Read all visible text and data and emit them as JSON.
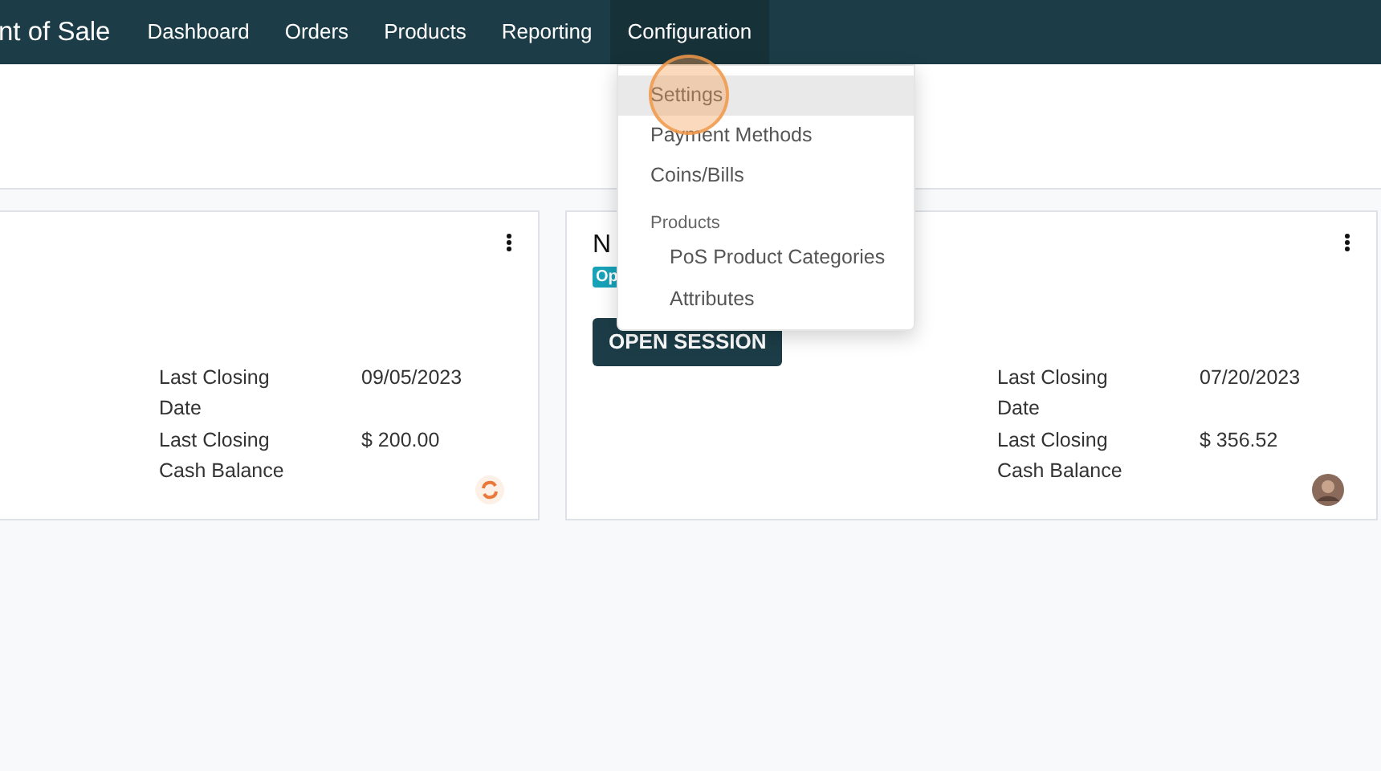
{
  "navbar": {
    "app_title": "nt of Sale",
    "menus": [
      {
        "label": "Dashboard",
        "selected": false
      },
      {
        "label": "Orders",
        "selected": false
      },
      {
        "label": "Products",
        "selected": false
      },
      {
        "label": "Reporting",
        "selected": false
      },
      {
        "label": "Configuration",
        "selected": true
      }
    ]
  },
  "dropdown": {
    "items": [
      {
        "kind": "item",
        "label": "Settings",
        "selected": true
      },
      {
        "kind": "item",
        "label": "Payment Methods",
        "selected": false
      },
      {
        "kind": "item",
        "label": "Coins/Bills",
        "selected": false
      },
      {
        "kind": "group",
        "label": "Products",
        "children": [
          {
            "label": "PoS Product Categories",
            "selected": false
          },
          {
            "label": "Attributes",
            "selected": false
          }
        ]
      }
    ]
  },
  "cards": [
    {
      "stats": [
        {
          "label": "Last Closing Date",
          "value": "09/05/2023"
        },
        {
          "label": "Last Closing Cash Balance",
          "value": "$ 200.00"
        }
      ],
      "owner": {
        "kind": "logo"
      }
    },
    {
      "title": "N",
      "badge": "Op",
      "button": "OPEN SESSION",
      "stats": [
        {
          "label": "Last Closing Date",
          "value": "07/20/2023"
        },
        {
          "label": "Last Closing Cash Balance",
          "value": "$ 356.52"
        }
      ],
      "owner": {
        "kind": "avatar"
      }
    }
  ]
}
